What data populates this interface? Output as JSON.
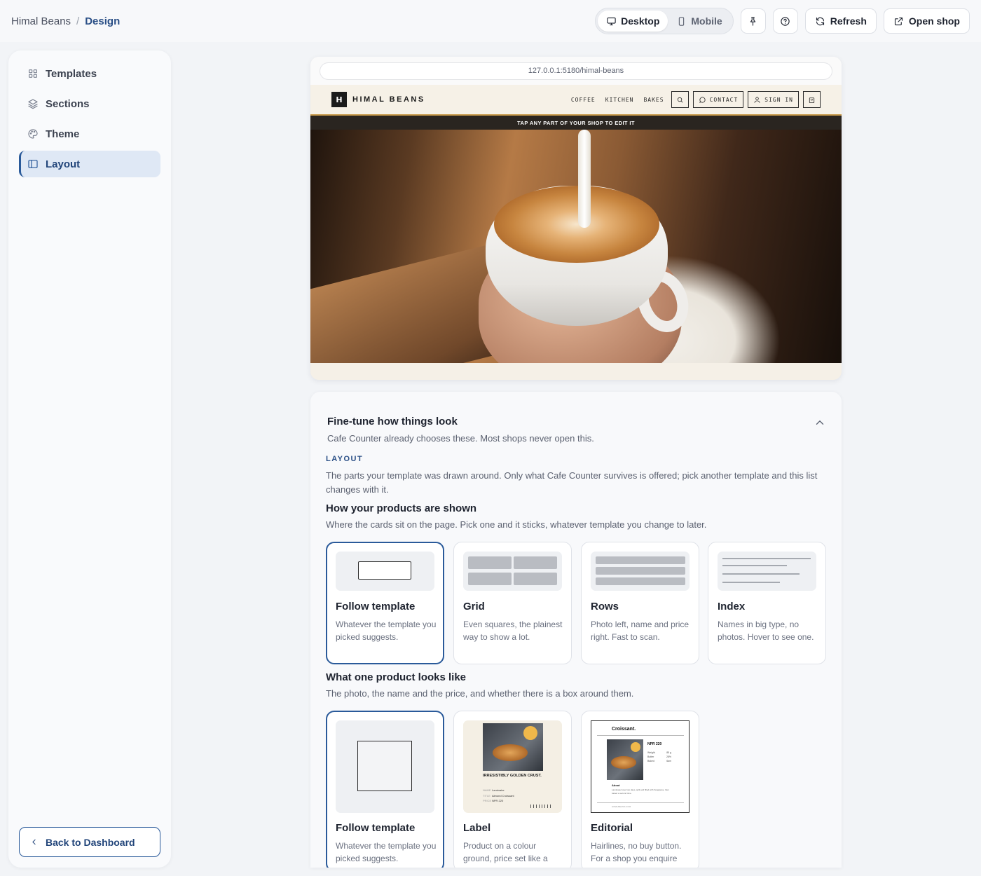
{
  "breadcrumb": {
    "shop": "Himal Beans",
    "separator": "/",
    "current": "Design"
  },
  "toolbar": {
    "view_desktop": "Desktop",
    "view_mobile": "Mobile",
    "refresh": "Refresh",
    "open_shop": "Open shop"
  },
  "sidebar": {
    "items": [
      {
        "label": "Templates",
        "icon": "grid-icon"
      },
      {
        "label": "Sections",
        "icon": "layers-icon"
      },
      {
        "label": "Theme",
        "icon": "palette-icon"
      },
      {
        "label": "Layout",
        "icon": "layout-icon",
        "active": true
      }
    ],
    "back": "Back to Dashboard"
  },
  "preview": {
    "url": "127.0.0.1:5180/himal-beans",
    "logo_letter": "H",
    "shop_name": "HIMAL BEANS",
    "nav_links": [
      "COFFEE",
      "KITCHEN",
      "BAKES"
    ],
    "contact": "CONTACT",
    "sign_in": "SIGN IN",
    "banner": "TAP ANY PART OF YOUR SHOP TO EDIT IT"
  },
  "panel": {
    "title": "Fine-tune how things look",
    "subtitle": "Cafe Counter already chooses these. Most shops never open this.",
    "kicker": "LAYOUT",
    "description": "The parts your template was drawn around. Only what Cafe Counter survives is offered; pick another template and this list changes with it.",
    "products_shown": {
      "title": "How your products are shown",
      "subtitle": "Where the cards sit on the page. Pick one and it sticks, whatever template you change to later.",
      "options": [
        {
          "name": "Follow template",
          "desc": "Whatever the template you picked suggests.",
          "selected": true
        },
        {
          "name": "Grid",
          "desc": "Even squares, the plainest way to show a lot."
        },
        {
          "name": "Rows",
          "desc": "Photo left, name and price right. Fast to scan."
        },
        {
          "name": "Index",
          "desc": "Names in big type, no photos. Hover to see one."
        }
      ]
    },
    "product_look": {
      "title": "What one product looks like",
      "subtitle": "The photo, the name and the price, and whether there is a box around them.",
      "options": [
        {
          "name": "Follow template",
          "desc": "Whatever the template you picked suggests.",
          "selected": true
        },
        {
          "name": "Label",
          "desc": "Product on a colour ground, price set like a"
        },
        {
          "name": "Editorial",
          "desc": "Hairlines, no buy button. For a shop you enquire"
        }
      ],
      "label_thumb": {
        "headline": "IRRESISTIBLY GOLDEN CRUST.",
        "rows": [
          [
            "NAME",
            "Laminaire"
          ],
          [
            "TITLE",
            "Almond Croissant"
          ],
          [
            "PRICE",
            "NPR 220"
          ]
        ]
      },
      "editorial_thumb": {
        "title": "Croissant.",
        "price": "NPR 220",
        "specs": [
          [
            "Weight",
            "85 g"
          ],
          [
            "Butter",
            "28%"
          ],
          [
            "Baked",
            "6am"
          ]
        ],
        "about_label": "About",
        "about_text": "Laminated over two days, split and filled with frangipane, then baked a second time.",
        "footer": "HIMALBEANS.COM"
      }
    }
  }
}
